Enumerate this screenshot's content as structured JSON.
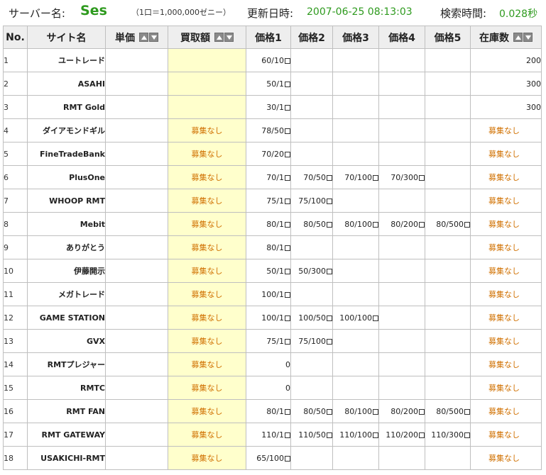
{
  "header": {
    "server_label": "サーバー名:",
    "server_name": "Ses",
    "unit_note": "（1口＝1,000,000ゼニー）",
    "update_label": "更新日時:",
    "update_value": "2007-06-25 08:13:03",
    "search_label": "検索時間:",
    "search_value": "0.028秒"
  },
  "columns": {
    "no": "No.",
    "site": "サイト名",
    "unit_price": "単価",
    "buy_price": "買取額",
    "price1": "価格1",
    "price2": "価格2",
    "price3": "価格3",
    "price4": "価格4",
    "price5": "価格5",
    "stock": "在庫数"
  },
  "icons": {
    "sort_up": "sort-ascending-icon",
    "sort_down": "sort-descending-icon",
    "price_checkbox": "checkbox-icon"
  },
  "colors": {
    "accent_green": "#2e9a1e",
    "buy_bg": "#ffffcc",
    "not_recruiting": "#d07000",
    "header_bg": "#eeeeee"
  },
  "rows": [
    {
      "no": "1",
      "site": "ユートレード",
      "unit": "",
      "buy": "",
      "prices": [
        "60/10",
        "",
        "",
        "",
        ""
      ],
      "stock": "200"
    },
    {
      "no": "2",
      "site": "ASAHI",
      "unit": "",
      "buy": "",
      "prices": [
        "50/1",
        "",
        "",
        "",
        ""
      ],
      "stock": "300"
    },
    {
      "no": "3",
      "site": "RMT Gold",
      "unit": "",
      "buy": "",
      "prices": [
        "30/1",
        "",
        "",
        "",
        ""
      ],
      "stock": "300"
    },
    {
      "no": "4",
      "site": "ダイアモンドギル",
      "unit": "",
      "buy": "募集なし",
      "prices": [
        "78/50",
        "",
        "",
        "",
        ""
      ],
      "stock": "募集なし"
    },
    {
      "no": "5",
      "site": "FineTradeBank",
      "unit": "",
      "buy": "募集なし",
      "prices": [
        "70/20",
        "",
        "",
        "",
        ""
      ],
      "stock": "募集なし"
    },
    {
      "no": "6",
      "site": "PlusOne",
      "unit": "",
      "buy": "募集なし",
      "prices": [
        "70/1",
        "70/50",
        "70/100",
        "70/300",
        ""
      ],
      "stock": "募集なし"
    },
    {
      "no": "7",
      "site": "WHOOP RMT",
      "unit": "",
      "buy": "募集なし",
      "prices": [
        "75/1",
        "75/100",
        "",
        "",
        ""
      ],
      "stock": "募集なし"
    },
    {
      "no": "8",
      "site": "Mebit",
      "unit": "",
      "buy": "募集なし",
      "prices": [
        "80/1",
        "80/50",
        "80/100",
        "80/200",
        "80/500"
      ],
      "stock": "募集なし"
    },
    {
      "no": "9",
      "site": "ありがとう",
      "unit": "",
      "buy": "募集なし",
      "prices": [
        "80/1",
        "",
        "",
        "",
        ""
      ],
      "stock": "募集なし"
    },
    {
      "no": "10",
      "site": "伊藤開示",
      "unit": "",
      "buy": "募集なし",
      "prices": [
        "50/1",
        "50/300",
        "",
        "",
        ""
      ],
      "stock": "募集なし"
    },
    {
      "no": "11",
      "site": "メガトレード",
      "unit": "",
      "buy": "募集なし",
      "prices": [
        "100/1",
        "",
        "",
        "",
        ""
      ],
      "stock": "募集なし"
    },
    {
      "no": "12",
      "site": "GAME STATION",
      "unit": "",
      "buy": "募集なし",
      "prices": [
        "100/1",
        "100/50",
        "100/100",
        "",
        ""
      ],
      "stock": "募集なし"
    },
    {
      "no": "13",
      "site": "GVX",
      "unit": "",
      "buy": "募集なし",
      "prices": [
        "75/1",
        "75/100",
        "",
        "",
        ""
      ],
      "stock": "募集なし"
    },
    {
      "no": "14",
      "site": "RMTプレジャー",
      "unit": "",
      "buy": "募集なし",
      "prices": [
        "0",
        "",
        "",
        "",
        ""
      ],
      "stock": "募集なし"
    },
    {
      "no": "15",
      "site": "RMTC",
      "unit": "",
      "buy": "募集なし",
      "prices": [
        "0",
        "",
        "",
        "",
        ""
      ],
      "stock": "募集なし"
    },
    {
      "no": "16",
      "site": "RMT FAN",
      "unit": "",
      "buy": "募集なし",
      "prices": [
        "80/1",
        "80/50",
        "80/100",
        "80/200",
        "80/500"
      ],
      "stock": "募集なし"
    },
    {
      "no": "17",
      "site": "RMT GATEWAY",
      "unit": "",
      "buy": "募集なし",
      "prices": [
        "110/1",
        "110/50",
        "110/100",
        "110/200",
        "110/300"
      ],
      "stock": "募集なし"
    },
    {
      "no": "18",
      "site": "USAKICHI-RMT",
      "unit": "",
      "buy": "募集なし",
      "prices": [
        "65/100",
        "",
        "",
        "",
        ""
      ],
      "stock": "募集なし"
    }
  ]
}
